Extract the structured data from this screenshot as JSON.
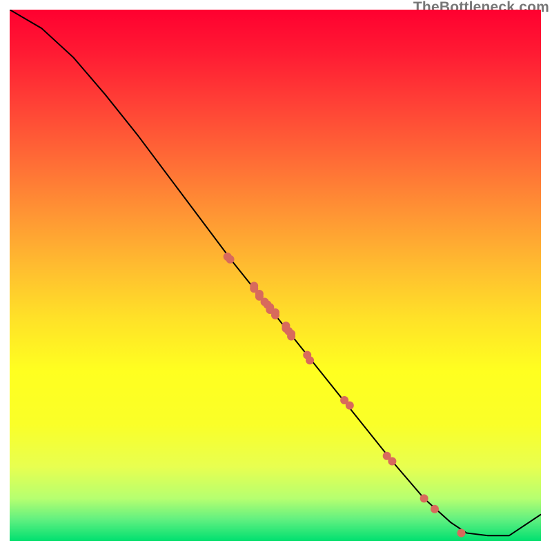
{
  "watermark": "TheBottleneck.com",
  "chart_data": {
    "type": "line",
    "title": "",
    "xlabel": "",
    "ylabel": "",
    "xlim": [
      0,
      100
    ],
    "ylim": [
      0,
      100
    ],
    "grid": false,
    "legend": false,
    "series": [
      {
        "name": "curve",
        "x": [
          0,
          6,
          12,
          18,
          24,
          30,
          36,
          42,
          48,
          54,
          60,
          66,
          72,
          78,
          83,
          86,
          90,
          94,
          100
        ],
        "y": [
          100,
          96.5,
          91,
          84,
          76.5,
          68.5,
          60.5,
          52.5,
          45,
          37.5,
          30,
          22.5,
          15,
          8,
          3.5,
          1.5,
          1,
          1,
          5
        ]
      }
    ],
    "points": {
      "name": "data-points",
      "x": [
        41,
        41.5,
        46,
        46,
        47,
        47,
        48,
        48.5,
        49,
        49,
        50,
        50,
        52,
        52,
        52.5,
        53,
        53,
        56,
        56.5,
        63,
        64,
        71,
        72,
        78,
        80,
        85
      ],
      "y": [
        53.5,
        53,
        47.5,
        48,
        46,
        46.5,
        45,
        44.5,
        44,
        43.5,
        43,
        42.5,
        40,
        40.5,
        39.5,
        39,
        38.5,
        35,
        34,
        26.5,
        25.5,
        16,
        15,
        8,
        6,
        1.5
      ]
    },
    "point_style": {
      "color": "#d86a5c",
      "radius": 6
    },
    "line_style": {
      "color": "#000000",
      "width": 2
    },
    "background_gradient": [
      "#ff0030",
      "#ffff20",
      "#00e070"
    ]
  }
}
